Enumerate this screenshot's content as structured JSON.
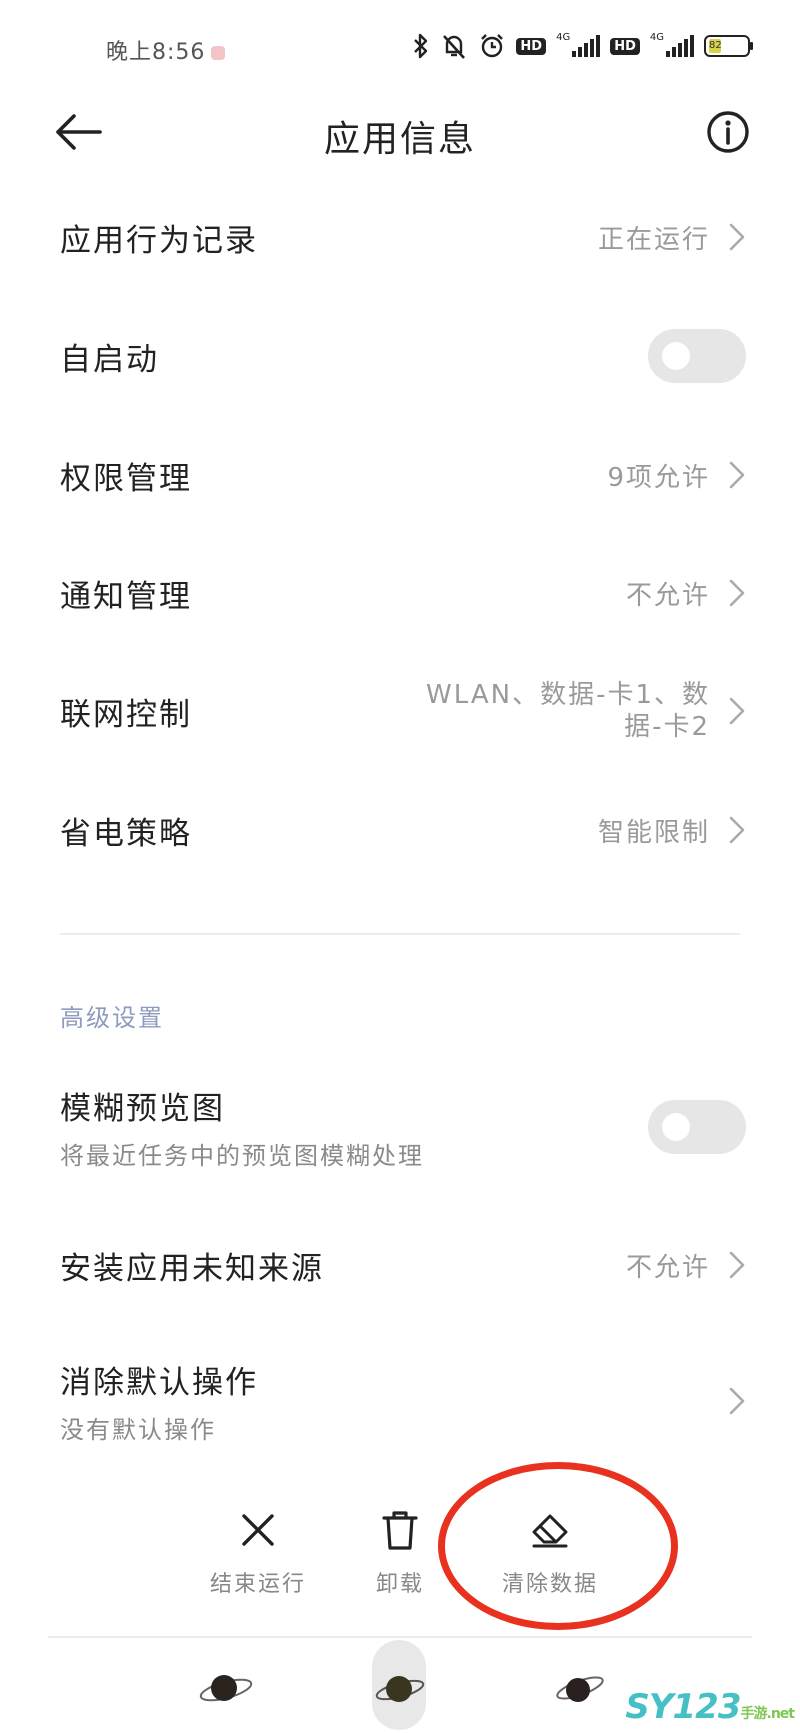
{
  "status_bar": {
    "time": "晚上8:56",
    "network_1": "4G",
    "network_2": "4G",
    "hd_1": "HD",
    "hd_2": "HD",
    "battery_level": "82"
  },
  "header": {
    "title": "应用信息"
  },
  "rows": [
    {
      "label": "应用行为记录",
      "value": "正在运行"
    },
    {
      "label": "自启动",
      "toggle": false
    },
    {
      "label": "权限管理",
      "value": "9项允许"
    },
    {
      "label": "通知管理",
      "value": "不允许"
    },
    {
      "label": "联网控制",
      "value_line1": "WLAN、数据-卡1、数",
      "value_line2": "据-卡2"
    },
    {
      "label": "省电策略",
      "value": "智能限制"
    }
  ],
  "advanced": {
    "section_title": "高级设置",
    "blur_preview": {
      "label": "模糊预览图",
      "description": "将最近任务中的预览图模糊处理",
      "toggle": false
    },
    "unknown_sources": {
      "label": "安装应用未知来源",
      "value": "不允许"
    },
    "clear_defaults": {
      "label": "消除默认操作",
      "description": "没有默认操作"
    }
  },
  "actions": {
    "stop": "结束运行",
    "uninstall": "卸载",
    "clear_data": "清除数据"
  },
  "watermark": {
    "text": "SY123",
    "suffix": "手游",
    "net": ".net"
  },
  "colors": {
    "highlight": "#e8321f",
    "section_title": "#8e9bc0",
    "secondary_text": "#9a9a9a"
  }
}
